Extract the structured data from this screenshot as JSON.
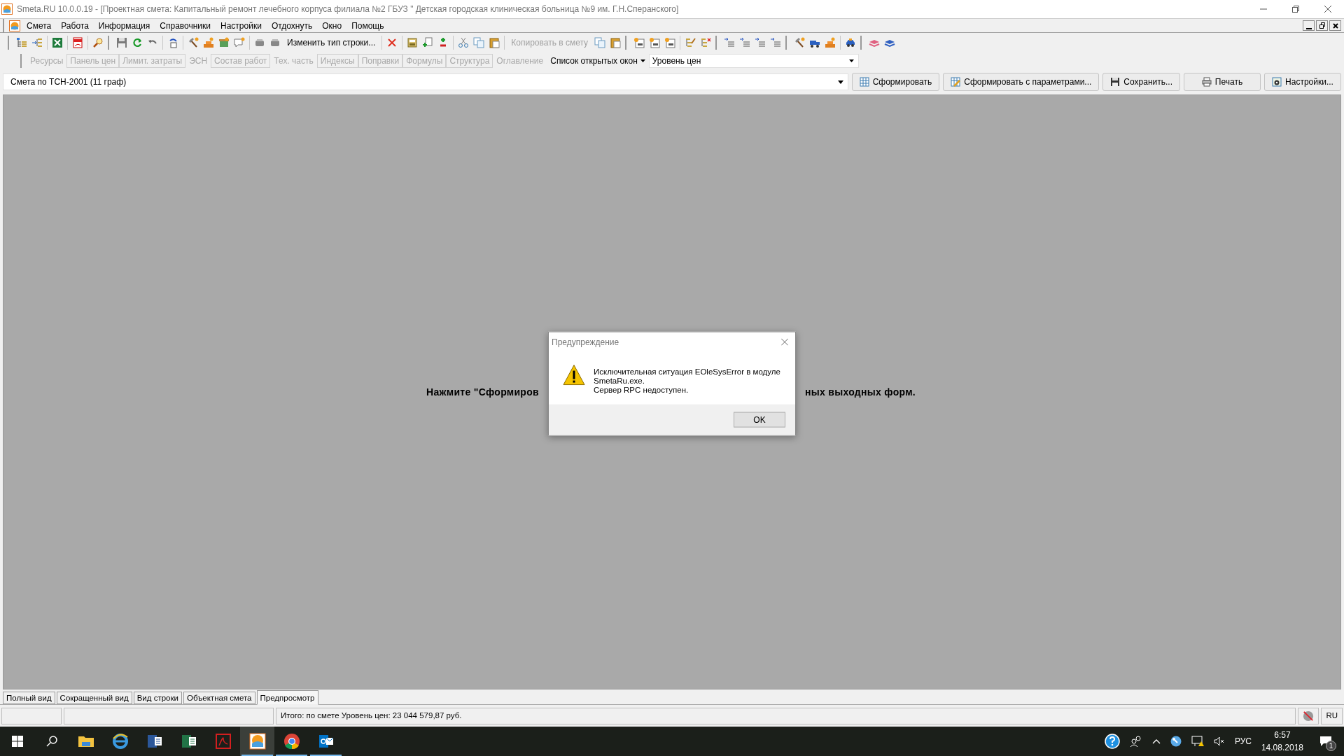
{
  "window": {
    "title": "Smeta.RU  10.0.0.19  - [Проектная смета: Капитальный ремонт лечебного корпуса филиала №2 ГБУЗ \" Детская городская клиническая больница №9 им. Г.Н.Сперанского]"
  },
  "menu": [
    {
      "label": "Смета"
    },
    {
      "label": "Работа"
    },
    {
      "label": "Информация"
    },
    {
      "label": "Справочники"
    },
    {
      "label": "Настройки"
    },
    {
      "label": "Отдохнуть"
    },
    {
      "label": "Окно"
    },
    {
      "label": "Помощь"
    }
  ],
  "toolbar": {
    "buttons": [
      {
        "label": "Изменить тип строки...",
        "disabled": false
      },
      {
        "label": "Копировать в смету",
        "disabled": true
      }
    ]
  },
  "panel_tabs": [
    {
      "label": "Ресурсы",
      "disabled": true,
      "boxed": false
    },
    {
      "label": "Панель цен",
      "disabled": true,
      "boxed": true
    },
    {
      "label": "Лимит. затраты",
      "disabled": true,
      "boxed": true
    },
    {
      "label": "ЭСН",
      "disabled": true,
      "boxed": false
    },
    {
      "label": "Состав работ",
      "disabled": true,
      "boxed": true
    },
    {
      "label": "Тех. часть",
      "disabled": true,
      "boxed": false
    },
    {
      "label": "Индексы",
      "disabled": true,
      "boxed": true
    },
    {
      "label": "Поправки",
      "disabled": true,
      "boxed": true
    },
    {
      "label": "Формулы",
      "disabled": true,
      "boxed": true
    },
    {
      "label": "Структура",
      "disabled": true,
      "boxed": true
    },
    {
      "label": "Оглавление",
      "disabled": true,
      "boxed": false
    }
  ],
  "open_windows": {
    "label": "Список открытых окон"
  },
  "price_level": {
    "value": "Уровень цен"
  },
  "form_select": {
    "value": "Смета по ТСН-2001 (11 граф)"
  },
  "form_buttons": [
    {
      "kind": "grid",
      "label": "Сформировать"
    },
    {
      "kind": "grid-pencil",
      "label": "Сформировать с параметрами..."
    },
    {
      "kind": "save",
      "label": "Сохранить..."
    },
    {
      "kind": "print",
      "label": "Печать"
    },
    {
      "kind": "settings",
      "label": "Настройки..."
    }
  ],
  "preview": {
    "hint_left": "Нажмите \"Сформиров",
    "hint_right": "ных выходных форм."
  },
  "dialog": {
    "title": "Предупреждение",
    "lines": [
      "Исключительная ситуация EOleSysError в модуле",
      "SmetaRu.exe.",
      "Сервер RPC недоступен."
    ],
    "button": "OK"
  },
  "view_tabs": [
    {
      "label": "Полный вид",
      "selected": false
    },
    {
      "label": "Сокращенный вид",
      "selected": false
    },
    {
      "label": "Вид строки",
      "selected": false
    },
    {
      "label": "Объектная смета",
      "selected": false
    },
    {
      "label": "Предпросмотр",
      "selected": true
    }
  ],
  "status_bar": {
    "total": "Итого: по смете Уровень цен: 23 044 579,87 руб.",
    "language": "RU"
  },
  "taskbar": {
    "apps": [
      {
        "kind": "folder",
        "running": false,
        "selected": false
      },
      {
        "kind": "browser-e",
        "running": false,
        "selected": false
      },
      {
        "kind": "word",
        "running": false,
        "selected": false
      },
      {
        "kind": "excel",
        "running": false,
        "selected": false
      },
      {
        "kind": "pdf",
        "running": false,
        "selected": false
      },
      {
        "kind": "smeta",
        "running": true,
        "selected": true
      },
      {
        "kind": "chrome",
        "running": true,
        "selected": false
      },
      {
        "kind": "mail",
        "running": true,
        "selected": false
      }
    ],
    "language": "РУС",
    "time": "6:57",
    "date": "14.08.2018",
    "notifications": "1"
  }
}
